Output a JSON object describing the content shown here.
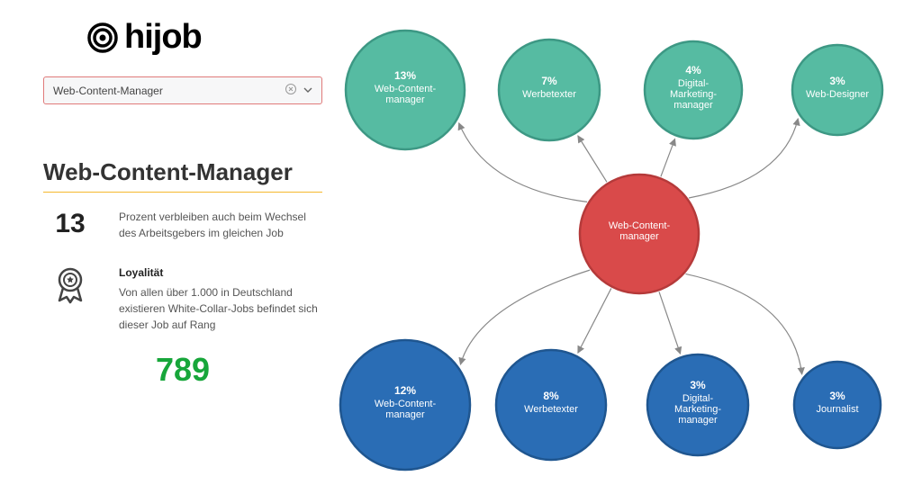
{
  "brand": "hijob",
  "dropdown": {
    "value": "Web-Content-Manager"
  },
  "title": "Web-Content-Manager",
  "retention": {
    "value": "13",
    "desc": "Prozent verbleiben auch beim Wechsel des Arbeitsgebers im gleichen Job"
  },
  "loyalty": {
    "heading": "Loyalität",
    "desc": "Von allen über 1.000 in Deutschland existieren White-Collar-Jobs befindet sich dieser Job auf Rang",
    "rank": "789"
  },
  "colors": {
    "teal": "#56bba2",
    "blue": "#2a6db5",
    "red": "#d94a4a",
    "accent_green": "#17a63a",
    "accent_yellow": "#f5b82e"
  },
  "chart_data": {
    "type": "node-link",
    "center": {
      "label": "Web-Content-manager"
    },
    "top_row": [
      {
        "pct": "13%",
        "label": "Web-Content-manager",
        "r": 66
      },
      {
        "pct": "7%",
        "label": "Werbetexter",
        "r": 56
      },
      {
        "pct": "4%",
        "label": "Digital-Marketing-manager",
        "r": 54
      },
      {
        "pct": "3%",
        "label": "Web-Designer",
        "r": 50
      }
    ],
    "bottom_row": [
      {
        "pct": "12%",
        "label": "Web-Content-manager",
        "r": 72
      },
      {
        "pct": "8%",
        "label": "Werbetexter",
        "r": 61
      },
      {
        "pct": "3%",
        "label": "Digital-Marketing-manager",
        "r": 56
      },
      {
        "pct": "3%",
        "label": "Journalist",
        "r": 48
      }
    ]
  }
}
